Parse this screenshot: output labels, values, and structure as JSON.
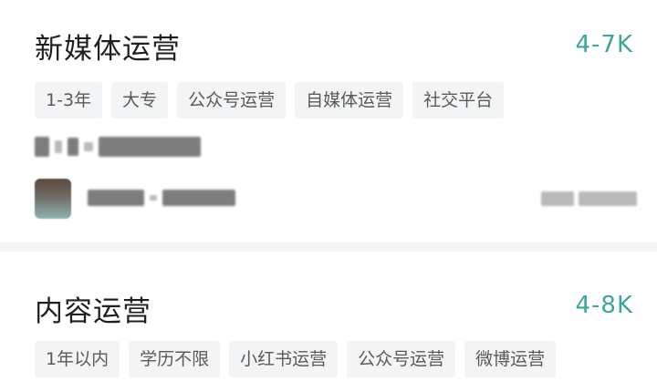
{
  "jobs": [
    {
      "title": "新媒体运营",
      "salary": "4-7K",
      "tags": [
        "1-3年",
        "大专",
        "公众号运营",
        "自媒体运营",
        "社交平台"
      ]
    },
    {
      "title": "内容运营",
      "salary": "4-8K",
      "tags": [
        "1年以内",
        "学历不限",
        "小红书运营",
        "公众号运营",
        "微博运营"
      ]
    }
  ],
  "colors": {
    "salary": "#3aa79a",
    "tag_bg": "#f3f4f5",
    "divider": "#f5f5f6"
  }
}
